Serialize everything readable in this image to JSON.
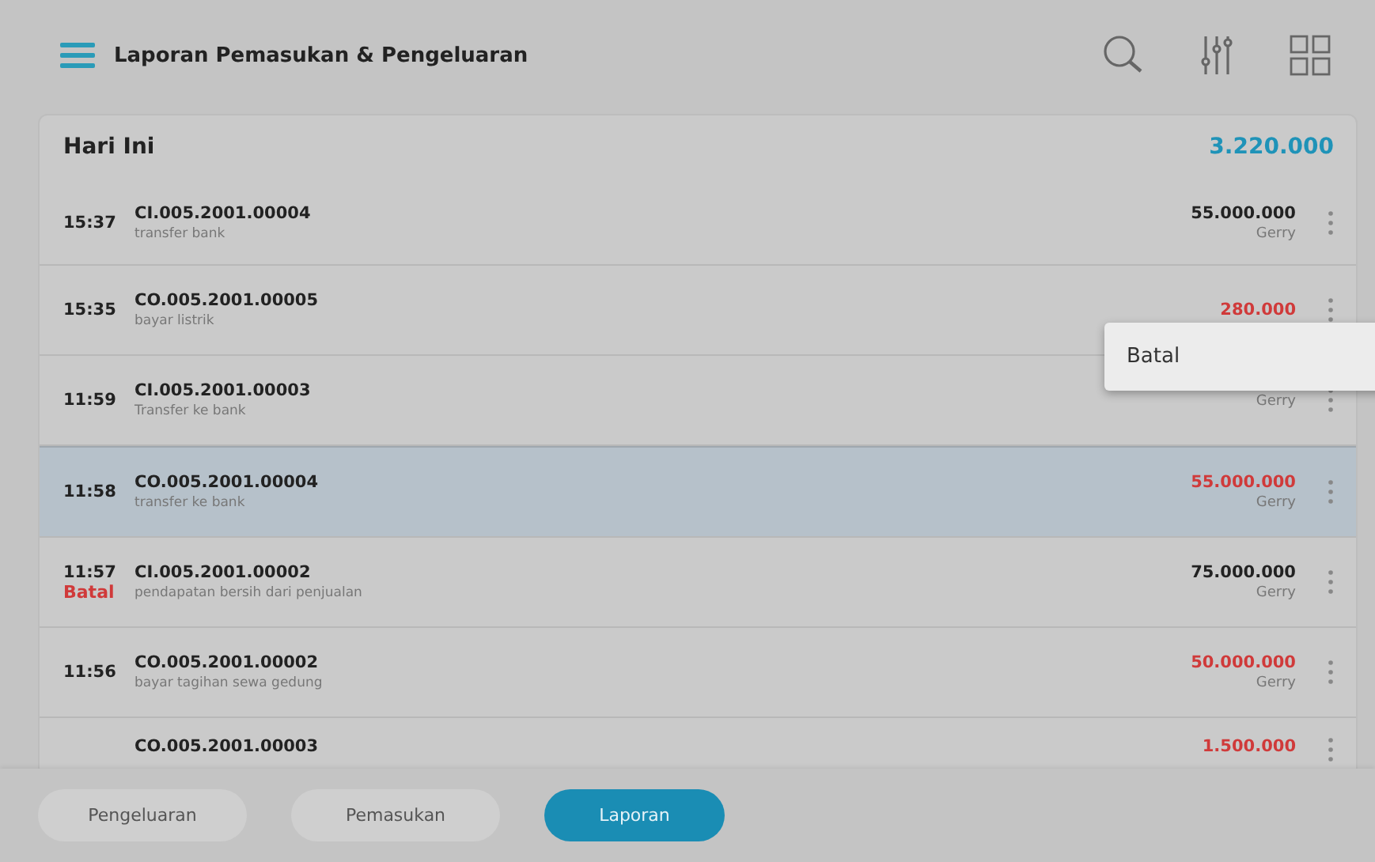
{
  "header": {
    "title": "Laporan Pemasukan & Pengeluaran"
  },
  "section": {
    "title": "Hari Ini",
    "total": "3.220.000"
  },
  "rows": [
    {
      "time": "15:37",
      "code": "CI.005.2001.00004",
      "note": "transfer bank",
      "amount": "55.000.000",
      "person": "Gerry",
      "kind": "in",
      "selected": false
    },
    {
      "time": "15:35",
      "code": "CO.005.2001.00005",
      "note": "bayar listrik",
      "amount": "280.000",
      "kind": "out",
      "selected": false
    },
    {
      "time": "11:59",
      "code": "CI.005.2001.00003",
      "note": "Transfer ke bank",
      "person": "Gerry",
      "selected": false
    },
    {
      "time": "11:58",
      "code": "CO.005.2001.00004",
      "note": "transfer ke bank",
      "amount": "55.000.000",
      "person": "Gerry",
      "kind": "out",
      "selected": true
    },
    {
      "time": "11:57",
      "status": "Batal",
      "code": "CI.005.2001.00002",
      "note": "pendapatan bersih dari penjualan",
      "amount": "75.000.000",
      "person": "Gerry",
      "kind": "in",
      "selected": false
    },
    {
      "time": "11:56",
      "code": "CO.005.2001.00002",
      "note": "bayar tagihan sewa gedung",
      "amount": "50.000.000",
      "person": "Gerry",
      "kind": "out",
      "selected": false
    },
    {
      "code": "CO.005.2001.00003",
      "amount": "1.500.000",
      "kind": "out",
      "selected": false
    }
  ],
  "context_menu": {
    "items": [
      "Batal"
    ]
  },
  "tabs": [
    {
      "label": "Pengeluaran",
      "selected": false
    },
    {
      "label": "Pemasukan",
      "selected": false
    },
    {
      "label": "Laporan",
      "selected": true
    }
  ]
}
